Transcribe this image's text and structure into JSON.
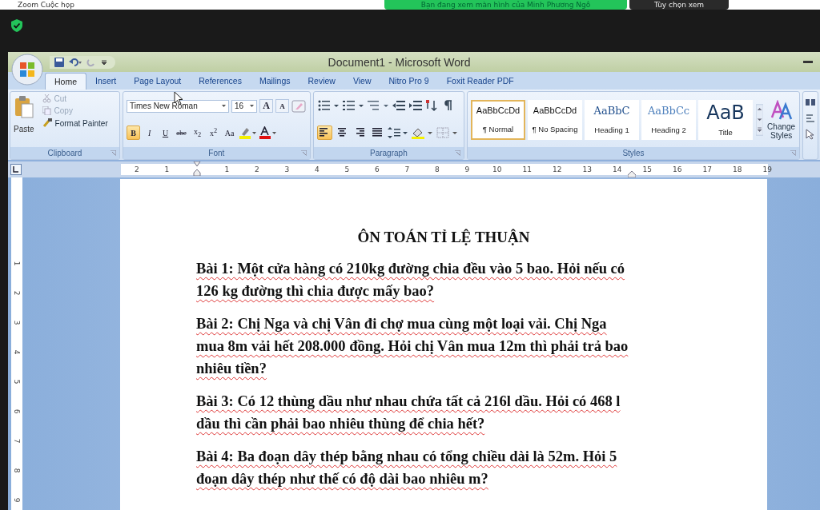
{
  "zoom_bar": {
    "app_title": "Zoom Cuộc họp",
    "share_banner": "Bạn đang xem màn hình của Minh Phương Ngô",
    "view_options": "Tùy chọn xem"
  },
  "word": {
    "title": "Document1 - Microsoft Word",
    "tabs": [
      {
        "label": "Home",
        "selected": true
      },
      {
        "label": "Insert",
        "selected": false
      },
      {
        "label": "Page Layout",
        "selected": false
      },
      {
        "label": "References",
        "selected": false
      },
      {
        "label": "Mailings",
        "selected": false
      },
      {
        "label": "Review",
        "selected": false
      },
      {
        "label": "View",
        "selected": false
      },
      {
        "label": "Nitro Pro 9",
        "selected": false
      },
      {
        "label": "Foxit Reader PDF",
        "selected": false
      }
    ],
    "clipboard": {
      "label": "Clipboard",
      "paste": "Paste",
      "cut": "Cut",
      "copy": "Copy",
      "format_painter": "Format Painter"
    },
    "font": {
      "label": "Font",
      "name": "Times New Roman",
      "size": "16",
      "grow": "A",
      "shrink": "A",
      "format_buttons": [
        {
          "kind": "bold",
          "label": "B",
          "selected": true
        },
        {
          "kind": "italic",
          "label": "I",
          "selected": false
        },
        {
          "kind": "underline",
          "label": "U",
          "selected": false
        },
        {
          "kind": "strike",
          "label": "abe",
          "selected": false
        },
        {
          "kind": "sub",
          "label": "x$_{2}$",
          "selected": false
        },
        {
          "kind": "sup",
          "label": "x$^{2}$",
          "selected": false
        },
        {
          "kind": "case",
          "label": "Aa",
          "selected": false
        }
      ]
    },
    "paragraph": {
      "label": "Paragraph",
      "align": [
        {
          "kind": "left",
          "selected": true
        },
        {
          "kind": "center",
          "selected": false
        },
        {
          "kind": "right",
          "selected": false
        },
        {
          "kind": "justify",
          "selected": false
        }
      ]
    },
    "styles": {
      "label": "Styles",
      "change_styles": "Change Styles",
      "items": [
        {
          "kind": "normal",
          "sample": "AaBbCcDd",
          "name": "¶ Normal",
          "selected": true
        },
        {
          "kind": "normal",
          "sample": "AaBbCcDd",
          "name": "¶ No Spacing",
          "selected": false
        },
        {
          "kind": "heading1",
          "sample": "AaBbC",
          "name": "Heading 1",
          "selected": false
        },
        {
          "kind": "heading2",
          "sample": "AaBbCc",
          "name": "Heading 2",
          "selected": false
        },
        {
          "kind": "title",
          "sample": "AaB",
          "name": "Title",
          "selected": false
        }
      ]
    },
    "ruler": {
      "horizontal": [
        "2",
        "1",
        "1",
        "2",
        "3",
        "4",
        "5",
        "6",
        "7",
        "8",
        "9",
        "10",
        "11",
        "12",
        "13",
        "14",
        "15",
        "16",
        "17",
        "18",
        "19"
      ],
      "vertical": [
        "1",
        "2",
        "3",
        "4",
        "5",
        "6",
        "7",
        "8",
        "9"
      ]
    },
    "document": {
      "heading": "ÔN TOÁN TỈ LỆ THUẬN",
      "spelling_marks": true,
      "paragraphs": [
        {
          "lines": [
            "Bài 1: Một cửa hàng có 210kg đường chia đều vào 5 bao. Hỏi nếu có",
            "126 kg đường thì chia được mấy bao?"
          ]
        },
        {
          "lines": [
            "Bài 2: Chị Nga và chị Vân đi chợ mua cùng một loại vải. Chị Nga",
            "mua 8m vải hết 208.000 đồng. Hỏi chị Vân mua 12m thì phải trả bao",
            "nhiêu tiền?"
          ]
        },
        {
          "lines": [
            "Bài 3: Có 12 thùng dầu như nhau chứa tất cả 216l dầu. Hỏi có 468 l",
            "dầu thì cần phải bao nhiêu thùng để chia hết?"
          ]
        },
        {
          "lines": [
            "Bài 4: Ba đoạn dây thép bằng nhau có tổng chiều dài là 52m. Hỏi 5",
            "đoạn dây thép như thế có độ dài bao nhiêu m?"
          ]
        }
      ]
    }
  }
}
